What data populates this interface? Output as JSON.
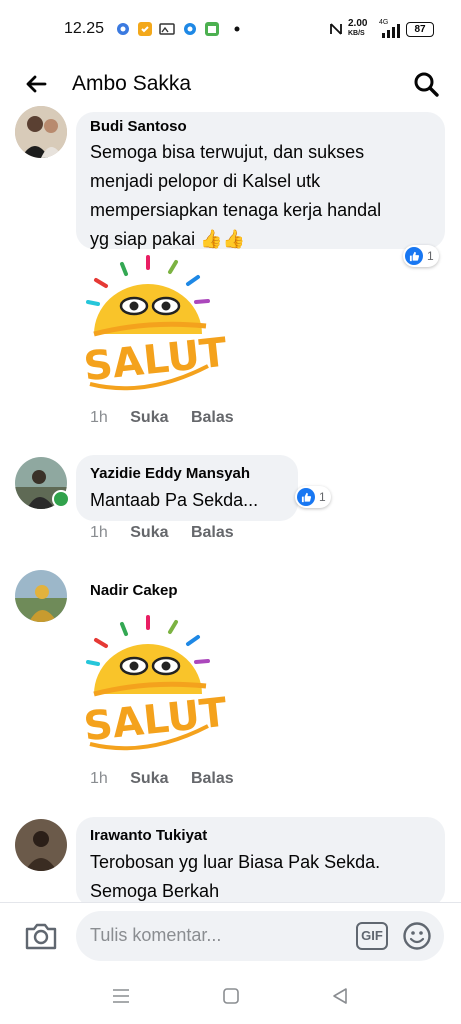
{
  "status_bar": {
    "time": "12.25",
    "network_speed_value": "2.00",
    "network_speed_unit": "KB/S",
    "network_type": "4G",
    "battery": "87"
  },
  "header": {
    "title": "Ambo Sakka"
  },
  "comments": [
    {
      "author": "Budi Santoso",
      "text_lines": [
        "Semoga bisa terwujut, dan sukses",
        "menjadi pelopor di Kalsel utk",
        "mempersiapkan tenaga kerja handal",
        "yg siap pakai 👍👍"
      ],
      "reaction_count": "1",
      "sticker_text": "SALUT!",
      "time": "1h",
      "like_label": "Suka",
      "reply_label": "Balas"
    },
    {
      "author": "Yazidie Eddy Mansyah",
      "text_lines": [
        "Mantaab Pa Sekda..."
      ],
      "reaction_count": "1",
      "time": "1h",
      "like_label": "Suka",
      "reply_label": "Balas"
    },
    {
      "author": "Nadir Cakep",
      "sticker_text": "SALUT!",
      "time": "1h",
      "like_label": "Suka",
      "reply_label": "Balas"
    },
    {
      "author": "Irawanto Tukiyat",
      "text_lines": [
        "Terobosan yg luar Biasa Pak Sekda.",
        "Semoga Berkah"
      ]
    }
  ],
  "composer": {
    "placeholder": "Tulis komentar...",
    "gif_label": "GIF"
  },
  "colors": {
    "accent": "#1877f2",
    "bubble": "#f0f2f5",
    "online": "#31a24c",
    "sticker_sun": "#f9c42a",
    "sticker_text": "#f4a21d"
  }
}
